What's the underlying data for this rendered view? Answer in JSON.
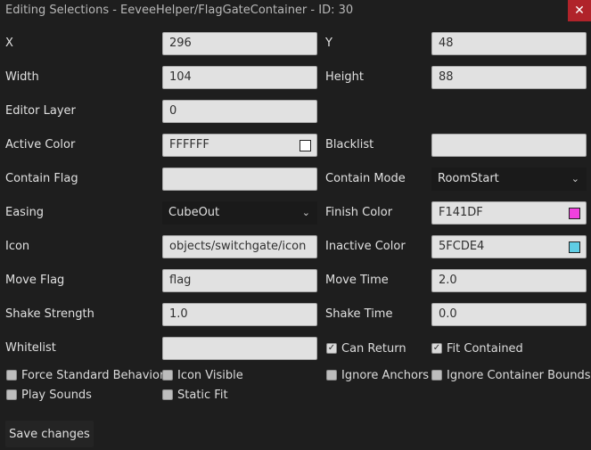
{
  "window": {
    "title": "Editing Selections - EeveeHelper/FlagGateContainer - ID: 30",
    "close_glyph": "✕"
  },
  "fields": {
    "x": {
      "label": "X",
      "value": "296"
    },
    "y": {
      "label": "Y",
      "value": "48"
    },
    "width": {
      "label": "Width",
      "value": "104"
    },
    "height": {
      "label": "Height",
      "value": "88"
    },
    "editor_layer": {
      "label": "Editor Layer",
      "value": "0"
    },
    "active_color": {
      "label": "Active Color",
      "value": "FFFFFF",
      "color": "#FFFFFF"
    },
    "blacklist": {
      "label": "Blacklist",
      "value": ""
    },
    "contain_flag": {
      "label": "Contain Flag",
      "value": ""
    },
    "contain_mode": {
      "label": "Contain Mode",
      "value": "RoomStart"
    },
    "easing": {
      "label": "Easing",
      "value": "CubeOut"
    },
    "finish_color": {
      "label": "Finish Color",
      "value": "F141DF",
      "color": "#F141DF"
    },
    "icon": {
      "label": "Icon",
      "value": "objects/switchgate/icon"
    },
    "inactive_color": {
      "label": "Inactive Color",
      "value": "5FCDE4",
      "color": "#5FCDE4"
    },
    "move_flag": {
      "label": "Move Flag",
      "value": "flag"
    },
    "move_time": {
      "label": "Move Time",
      "value": "2.0"
    },
    "shake_strength": {
      "label": "Shake Strength",
      "value": "1.0"
    },
    "shake_time": {
      "label": "Shake Time",
      "value": "0.0"
    },
    "whitelist": {
      "label": "Whitelist",
      "value": ""
    }
  },
  "checkboxes": {
    "can_return": {
      "label": "Can Return",
      "checked": true
    },
    "fit_contained": {
      "label": "Fit Contained",
      "checked": true
    },
    "force_standard_behavior": {
      "label": "Force Standard Behavior",
      "checked": false
    },
    "icon_visible": {
      "label": "Icon Visible",
      "checked": false
    },
    "ignore_anchors": {
      "label": "Ignore Anchors",
      "checked": false
    },
    "ignore_container_bounds": {
      "label": "Ignore Container Bounds",
      "checked": false
    },
    "play_sounds": {
      "label": "Play Sounds",
      "checked": false
    },
    "static_fit": {
      "label": "Static Fit",
      "checked": false
    }
  },
  "check_glyph": "✓",
  "chevron_glyph": "⌄",
  "actions": {
    "save_label": "Save changes"
  },
  "colors": {
    "close": "#B0232A",
    "background": "#1E1E1E"
  }
}
